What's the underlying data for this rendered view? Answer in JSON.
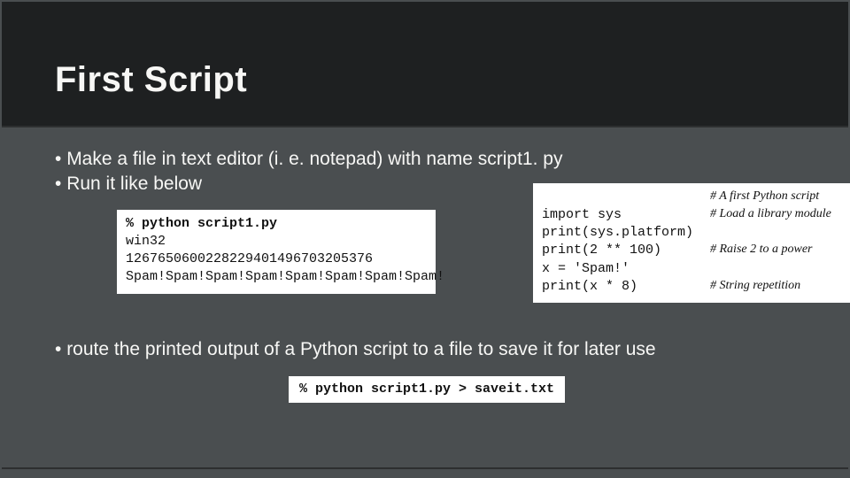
{
  "title": "First Script",
  "bullets_top": [
    "Make a file in text editor (i. e. notepad) with name script1. py",
    "Run it like below"
  ],
  "terminal_left": {
    "cmd": "% python script1.py",
    "out": [
      "win32",
      "1267650600228229401496703205376",
      "Spam!Spam!Spam!Spam!Spam!Spam!Spam!Spam!"
    ]
  },
  "script_code": {
    "lines": [
      {
        "code": "",
        "comment": "# A first Python script"
      },
      {
        "code": "import sys",
        "comment": "# Load a library module"
      },
      {
        "code": "print(sys.platform)",
        "comment": ""
      },
      {
        "code": "print(2 ** 100)",
        "comment": "# Raise 2 to a power"
      },
      {
        "code": "x = 'Spam!'",
        "comment": ""
      },
      {
        "code": "print(x * 8)",
        "comment": "# String repetition"
      }
    ]
  },
  "bullet_bottom": " route the printed output of a Python script to a file to save it for later use",
  "terminal_route": "% python script1.py > saveit.txt"
}
